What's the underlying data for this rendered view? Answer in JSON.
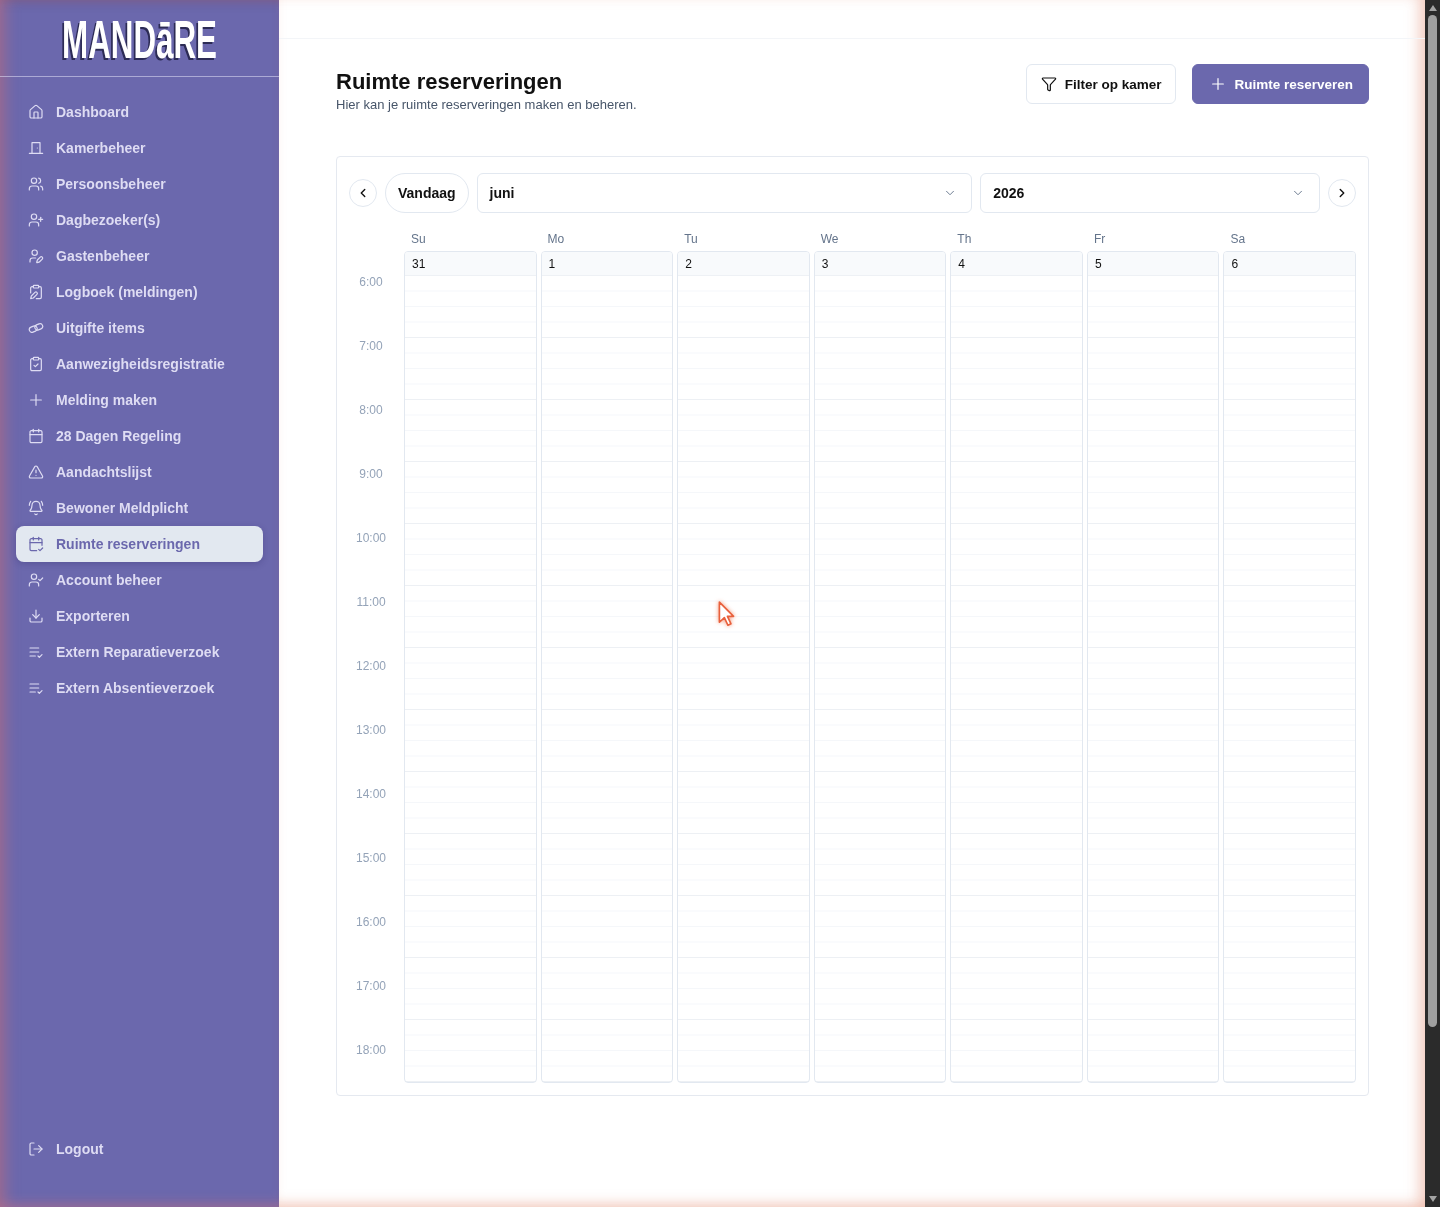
{
  "logo": {
    "text": "MANDāRE"
  },
  "sidebar": {
    "items": [
      {
        "label": "Dashboard",
        "selected": false
      },
      {
        "label": "Kamerbeheer",
        "selected": false
      },
      {
        "label": "Persoonsbeheer",
        "selected": false
      },
      {
        "label": "Dagbezoeker(s)",
        "selected": false
      },
      {
        "label": "Gastenbeheer",
        "selected": false
      },
      {
        "label": "Logboek (meldingen)",
        "selected": false
      },
      {
        "label": "Uitgifte items",
        "selected": false
      },
      {
        "label": "Aanwezigheidsregistratie",
        "selected": false
      },
      {
        "label": "Melding maken",
        "selected": false
      },
      {
        "label": "28 Dagen Regeling",
        "selected": false
      },
      {
        "label": "Aandachtslijst",
        "selected": false
      },
      {
        "label": "Bewoner Meldplicht",
        "selected": false
      },
      {
        "label": "Ruimte reserveringen",
        "selected": true
      },
      {
        "label": "Account beheer",
        "selected": false
      },
      {
        "label": "Exporteren",
        "selected": false
      },
      {
        "label": "Extern Reparatieverzoek",
        "selected": false
      },
      {
        "label": "Extern Absentieverzoek",
        "selected": false
      }
    ],
    "logout": {
      "label": "Logout"
    }
  },
  "header": {
    "title": "Ruimte reserveringen",
    "subtitle": "Hier kan je ruimte reserveringen maken en beheren.",
    "buttons": [
      {
        "label": "Filter op kamer",
        "kind": "secondary"
      },
      {
        "label": "Ruimte reserveren",
        "kind": "primary"
      }
    ]
  },
  "calendar": {
    "today_button": "Vandaag",
    "month": "juni",
    "year": "2026",
    "days": [
      {
        "weekday": "Su",
        "date": "31"
      },
      {
        "weekday": "Mo",
        "date": "1"
      },
      {
        "weekday": "Tu",
        "date": "2"
      },
      {
        "weekday": "We",
        "date": "3"
      },
      {
        "weekday": "Th",
        "date": "4"
      },
      {
        "weekday": "Fr",
        "date": "5"
      },
      {
        "weekday": "Sa",
        "date": "6"
      }
    ],
    "times": [
      "6:00",
      "7:00",
      "8:00",
      "9:00",
      "10:00",
      "11:00",
      "12:00",
      "13:00",
      "14:00",
      "15:00",
      "16:00",
      "17:00",
      "18:00"
    ]
  }
}
